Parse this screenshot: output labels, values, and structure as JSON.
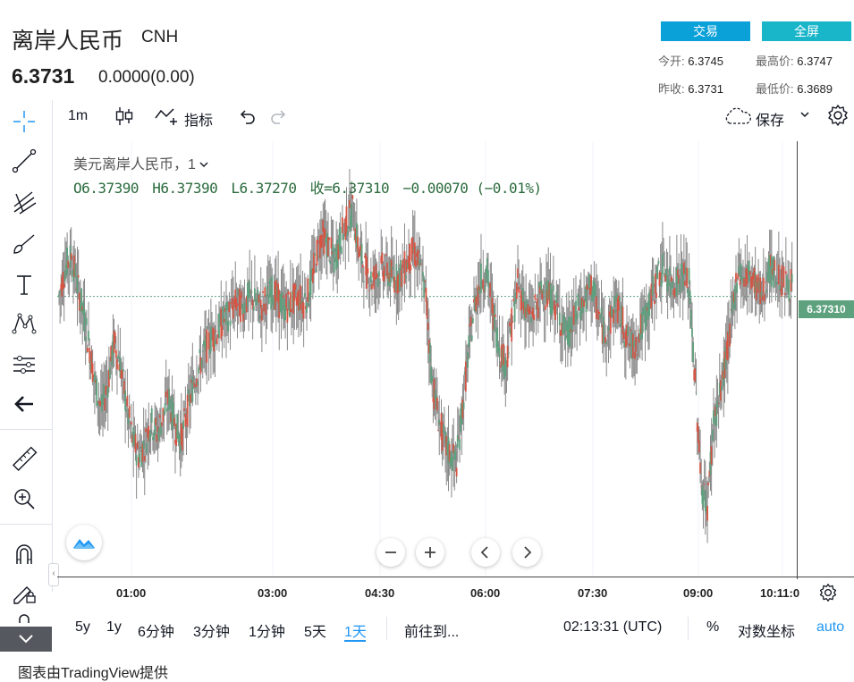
{
  "header": {
    "title": "离岸人民币",
    "symbol": "CNH",
    "price": "6.3731",
    "change": "0.0000(0.00)",
    "trade_button": "交易",
    "fullscreen_button": "全屏",
    "stats": {
      "open_label": "今开:",
      "open_value": "6.3745",
      "high_label": "最高价:",
      "high_value": "6.3747",
      "prev_close_label": "昨收:",
      "prev_close_value": "6.3731",
      "low_label": "最低价:",
      "low_value": "6.3689"
    }
  },
  "toolbar": {
    "interval": "1m",
    "indicators_label": "指标",
    "save_label": "保存",
    "icons": [
      "candles-icon",
      "indicators-icon",
      "undo-icon",
      "redo-icon",
      "cloud-icon",
      "chevron-down-icon",
      "gear-icon"
    ]
  },
  "left_toolbar": {
    "icons": [
      "crosshair-icon",
      "trend-line-icon",
      "pitchfork-icon",
      "brush-icon",
      "text-icon",
      "pattern-icon",
      "measure-icon",
      "back-arrow-icon",
      "ruler-icon",
      "zoom-in-icon",
      "magnet-icon",
      "lock-edit-icon",
      "lock-icon",
      "collapse-icon"
    ]
  },
  "legend": {
    "name": "美元离岸人民币，1",
    "open": "O6.37390",
    "high": "H6.37390",
    "low": "L6.37270",
    "close": "收=6.37310",
    "change": "−0.00070 (−0.01%)"
  },
  "price_tag": "6.37310",
  "colors": {
    "up": "#5ea17e",
    "down": "#d75442",
    "wick": "#888888",
    "accent": "#2196f3"
  },
  "chart_data": {
    "type": "candlestick",
    "x_ticks": [
      "01:00",
      "03:00",
      "04:30",
      "06:00",
      "07:30",
      "09:00",
      "10:11:0"
    ],
    "y_range": [
      6.3689,
      6.3747
    ],
    "last_price": 6.3731,
    "grid": true,
    "close_series": [
      6.3731,
      6.3736,
      6.3738,
      6.3733,
      6.3728,
      6.3722,
      6.3715,
      6.3711,
      6.3716,
      6.3723,
      6.3719,
      6.3712,
      6.3706,
      6.3703,
      6.3705,
      6.3709,
      6.3707,
      6.371,
      6.3713,
      6.3708,
      6.3706,
      6.3711,
      6.3716,
      6.3719,
      6.3722,
      6.3724,
      6.3725,
      6.3727,
      6.3728,
      6.373,
      6.3729,
      6.3731,
      6.373,
      6.3729,
      6.3731,
      6.3732,
      6.373,
      6.3729,
      6.373,
      6.3731,
      6.373,
      6.3732,
      6.3738,
      6.3742,
      6.374,
      6.3737,
      6.3741,
      6.3744,
      6.3746,
      6.3739,
      6.3736,
      6.3734,
      6.3735,
      6.3736,
      6.3735,
      6.3734,
      6.3735,
      6.3737,
      6.3739,
      6.3736,
      6.3731,
      6.3716,
      6.371,
      6.3705,
      6.3703,
      6.3702,
      6.3712,
      6.3722,
      6.373,
      6.3734,
      6.3735,
      6.3728,
      6.3722,
      6.3719,
      6.3726,
      6.3733,
      6.373,
      6.3727,
      6.3729,
      6.3732,
      6.3731,
      6.373,
      6.3727,
      6.3724,
      6.3726,
      6.3729,
      6.373,
      6.3733,
      6.3729,
      6.3725,
      6.3726,
      6.373,
      6.3727,
      6.3723,
      6.3722,
      6.3725,
      6.3728,
      6.3731,
      6.3735,
      6.3736,
      6.3733,
      6.3734,
      6.3735,
      6.3733,
      6.3716,
      6.3698,
      6.3694,
      6.3709,
      6.3713,
      6.372,
      6.3727,
      6.3736,
      6.3734,
      6.3735,
      6.3733,
      6.3731,
      6.3736,
      6.3735,
      6.3734,
      6.3733
    ]
  },
  "time_axis": {
    "ticks": [
      "01:00",
      "03:00",
      "04:30",
      "06:00",
      "07:30",
      "09:00",
      "10:11:0"
    ]
  },
  "bottom_bar": {
    "ranges": [
      "5y",
      "1y",
      "6分钟",
      "3分钟",
      "1分钟",
      "5天",
      "1天"
    ],
    "goto": "前往到...",
    "clock": "02:13:31 (UTC)",
    "percent": "%",
    "log_scale": "对数坐标",
    "auto": "auto"
  },
  "footer": {
    "attribution": "图表由TradingView提供"
  }
}
